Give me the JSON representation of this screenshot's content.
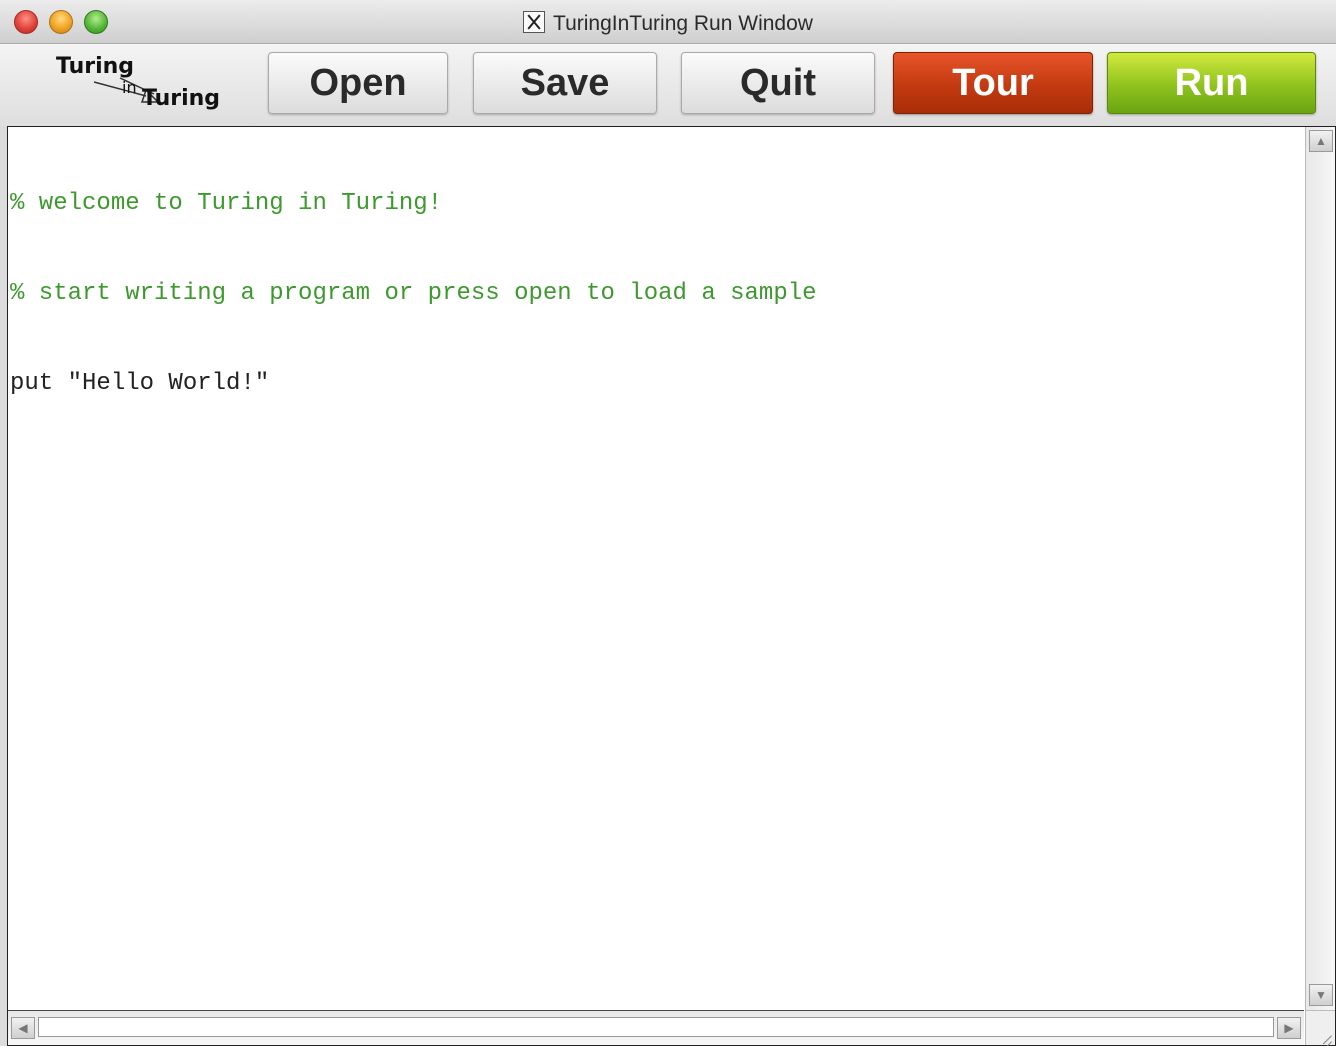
{
  "window": {
    "title": "TuringInTuring Run Window"
  },
  "logo": {
    "line1": "Turing",
    "line2": "in",
    "line3": "Turing"
  },
  "toolbar": {
    "open_label": "Open",
    "save_label": "Save",
    "quit_label": "Quit",
    "tour_label": "Tour",
    "run_label": "Run"
  },
  "editor": {
    "lines": [
      {
        "kind": "comment",
        "text": "% welcome to Turing in Turing!"
      },
      {
        "kind": "comment",
        "text": "% start writing a program or press open to load a sample"
      },
      {
        "kind": "code",
        "text": "put \"Hello World!\""
      }
    ]
  },
  "colors": {
    "comment": "#3c9a2d",
    "tour_button": "#c33a10",
    "run_button": "#8fc21e"
  },
  "icons": {
    "title_icon": "x11-icon",
    "scroll_up": "arrow-up-icon",
    "scroll_down": "arrow-down-icon",
    "scroll_left": "arrow-left-icon",
    "scroll_right": "arrow-right-icon",
    "resize": "resize-grip-icon"
  }
}
